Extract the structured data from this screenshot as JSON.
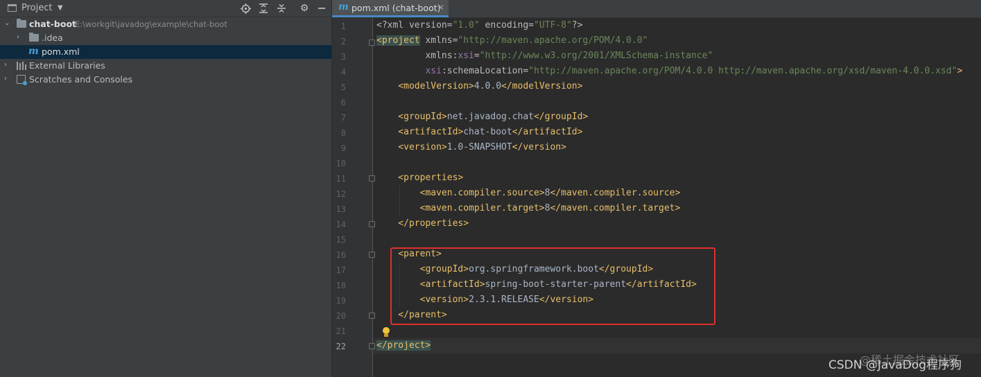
{
  "project_panel": {
    "title": "Project",
    "toolbar_icons": [
      "locate-icon",
      "expand-all-icon",
      "collapse-all-icon",
      "gear-icon",
      "minimize-icon"
    ],
    "tree": [
      {
        "label": "chat-boot",
        "path": "E:\\workgit\\javadog\\example\\chat-boot",
        "icon": "folder-icon",
        "expanded": true
      },
      {
        "label": ".idea",
        "icon": "folder-icon",
        "expanded": false
      },
      {
        "label": "pom.xml",
        "icon": "maven-icon",
        "selected": true
      },
      {
        "label": "External Libraries",
        "icon": "library-icon",
        "expanded": false
      },
      {
        "label": "Scratches and Consoles",
        "icon": "scratch-icon",
        "expanded": false
      }
    ]
  },
  "editor": {
    "tab_label": "pom.xml (chat-boot)",
    "current_line": 22,
    "line_numbers": [
      "1",
      "2",
      "3",
      "4",
      "5",
      "6",
      "7",
      "8",
      "9",
      "10",
      "11",
      "12",
      "13",
      "14",
      "15",
      "16",
      "17",
      "18",
      "19",
      "20",
      "21",
      "22"
    ],
    "code": {
      "l1_p1": "<?xml version=",
      "l1_p2": "\"1.0\"",
      "l1_p3": " encoding=",
      "l1_p4": "\"UTF-8\"",
      "l1_p5": "?>",
      "l2_tag": "<project",
      "l2_attr": " xmlns=",
      "l2_val": "\"http://maven.apache.org/POM/4.0.0\"",
      "l3_indent": "         ",
      "l3_attr": "xmlns:",
      "l3_ns": "xsi",
      "l3_eq": "=",
      "l3_val": "\"http://www.w3.org/2001/XMLSchema-instance\"",
      "l4_indent": "         ",
      "l4_ns": "xsi",
      "l4_attr": ":schemaLocation=",
      "l4_val": "\"http://maven.apache.org/POM/4.0.0 http://maven.apache.org/xsd/maven-4.0.0.xsd\"",
      "l4_end": ">",
      "l5_open": "    <modelVersion>",
      "l5_text": "4.0.0",
      "l5_close": "</modelVersion>",
      "l7_open": "    <groupId>",
      "l7_text": "net.javadog.chat",
      "l7_close": "</groupId>",
      "l8_open": "    <artifactId>",
      "l8_text": "chat-boot",
      "l8_close": "</artifactId>",
      "l9_open": "    <version>",
      "l9_text": "1.0-SNAPSHOT",
      "l9_close": "</version>",
      "l11_open": "    <properties>",
      "l12_open": "        <maven.compiler.source>",
      "l12_text": "8",
      "l12_close": "</maven.compiler.source>",
      "l13_open": "        <maven.compiler.target>",
      "l13_text": "8",
      "l13_close": "</maven.compiler.target>",
      "l14_close": "    </properties>",
      "l16_open": "    <parent>",
      "l17_open": "        <groupId>",
      "l17_text": "org.springframework.boot",
      "l17_close": "</groupId>",
      "l18_open": "        <artifactId>",
      "l18_text": "spring-boot-starter-parent",
      "l18_close": "</artifactId>",
      "l19_open": "        <version>",
      "l19_text": "2.3.1.RELEASE",
      "l19_close": "</version>",
      "l20_close": "    </parent>",
      "l22_close": "</project>"
    }
  },
  "watermark": {
    "site": "@稀土掘金技术社区",
    "author": "CSDN @JavaDog程序狗"
  },
  "colors": {
    "tag": "#e8bf6a",
    "attribute_value": "#6a8759",
    "namespace": "#9876aa",
    "highlight_box": "#e02f2f",
    "selection": "#0d293e"
  }
}
